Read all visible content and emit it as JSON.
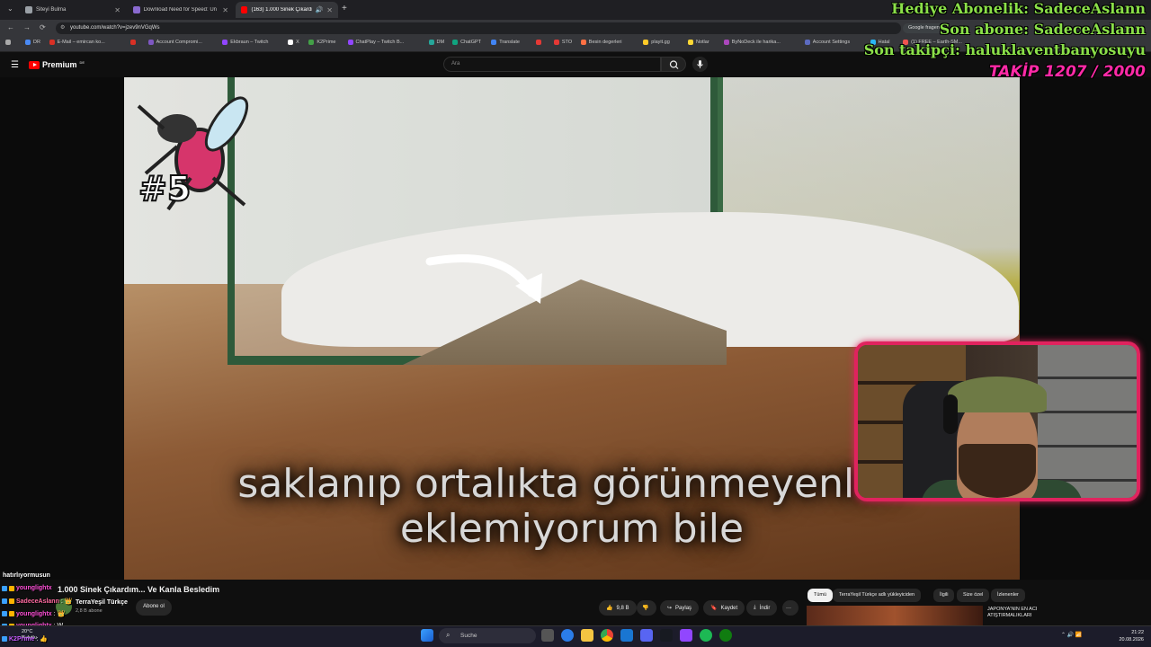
{
  "browser": {
    "tabs": [
      {
        "label": "Siteyi Bulma",
        "color": "#9aa0a6"
      },
      {
        "label": "Download Need for Speed: Un",
        "color": "#8a6ad0"
      },
      {
        "label": "(163) 1.000 Sinek Çıkardım",
        "color": "#ff0000"
      }
    ],
    "new_tab": "+",
    "url": "youtube.com/watch?v=jzev9nVGqWs",
    "bookmarks": [
      {
        "label": "DR",
        "color": "#4a8af4"
      },
      {
        "label": "E-Mail – emircan ko...",
        "color": "#d93025"
      },
      {
        "label": "",
        "color": "#d93025"
      },
      {
        "label": "Account Compromi...",
        "color": "#7e57c2"
      },
      {
        "label": "Ekbraun – Twitch",
        "color": "#9146ff"
      },
      {
        "label": "X",
        "color": "#ffffff"
      },
      {
        "label": "K2Prime",
        "color": "#43a047"
      },
      {
        "label": "ChatPlay – Twitch B...",
        "color": "#9146ff"
      },
      {
        "label": "DM",
        "color": "#26a69a"
      },
      {
        "label": "ChatGPT",
        "color": "#10a37f"
      },
      {
        "label": "Translate",
        "color": "#4285f4"
      },
      {
        "label": "",
        "color": "#e53935"
      },
      {
        "label": "STO",
        "color": "#e53935"
      },
      {
        "label": "Besin degerleri",
        "color": "#ff7043"
      },
      {
        "label": "playit.gg",
        "color": "#ffca28"
      },
      {
        "label": "Notlar",
        "color": "#fdd835"
      },
      {
        "label": "ByNoDeck ile harika...",
        "color": "#ab47bc"
      },
      {
        "label": "Account Settings",
        "color": "#5c6bc0"
      },
      {
        "label": "Hatal",
        "color": "#29b6f6"
      },
      {
        "label": "(1) FREE – Earth-SM...",
        "color": "#ef5350"
      }
    ],
    "google_chip": "Google fragen"
  },
  "youtube": {
    "premium_label": "Premium",
    "premium_region": "DE",
    "search_placeholder": "Ara",
    "caption_line1": "saklanıp ortalıkta görünmeyenleri",
    "caption_line2": "eklemiyorum bile",
    "badge_number": "#5",
    "video_title": "1.000 Sinek Çıkardım... Ve Kanla Besledim",
    "channel_name": "TerraYeşil Türkçe",
    "channel_subs": "2,8 B abone",
    "subscribe_label": "Abone ol",
    "like_count": "9,8 B",
    "share_label": "Paylaş",
    "save_label": "Kaydet",
    "download_label": "İndir",
    "more_label": "···",
    "chips": [
      "Tümü",
      "TerraYeşil Türkçe adlı yükleyiciden",
      "İlgili",
      "Size özel",
      "İzlenenler"
    ],
    "rec_title": "JAPONYA'NIN EN ACI ATIŞTIRMALIKLARI"
  },
  "stream_overlay": {
    "gift_sub": "Hediye Abonelik: SadeceAslann",
    "last_sub": "Son abone: SadeceAslann",
    "last_follow": "Son takipçi: haluklaventbanyosuyu",
    "follow_goal": "TAKİP 1207 / 2000"
  },
  "chat": {
    "label": "hatırlıyormusun",
    "lines": [
      {
        "user": "younglightx",
        "color": "#ff4fd8",
        "message": ""
      },
      {
        "user": "SadeceAslann",
        "color": "#ff6aa0",
        "message": ": 👑"
      },
      {
        "user": "younglightx",
        "color": "#ff4fd8",
        "message": ": 👑"
      },
      {
        "user": "younglightx",
        "color": "#ff4fd8",
        "message": ": W"
      },
      {
        "user": "K2Prime",
        "color": "#c85cff",
        "message": ": 👍"
      }
    ]
  },
  "taskbar": {
    "weather_temp": "20°C",
    "weather_desc": "Bulutlu",
    "search_label": "Suche",
    "time": "21:22",
    "date": "20.08.2026"
  }
}
